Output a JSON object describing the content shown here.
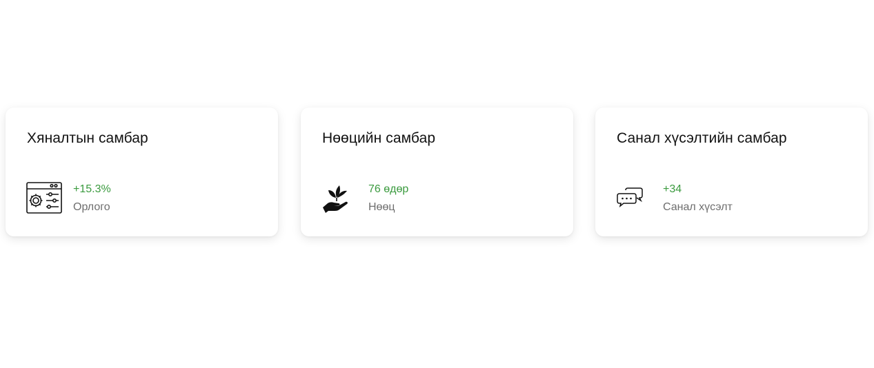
{
  "cards": [
    {
      "title": "Хяналтын самбар",
      "icon": "dashboard-settings-icon",
      "value": "+15.3%",
      "label": "Орлого"
    },
    {
      "title": "Нөөцийн самбар",
      "icon": "plant-hand-icon",
      "value": "76 өдөр",
      "label": "Нөөц"
    },
    {
      "title": "Санал хүсэлтийн самбар",
      "icon": "chat-bubbles-icon",
      "value": "+34",
      "label": "Санал хүсэлт"
    }
  ],
  "colors": {
    "value_green": "#3a9a3e",
    "label_gray": "#6e6e6e",
    "title": "#111111"
  }
}
